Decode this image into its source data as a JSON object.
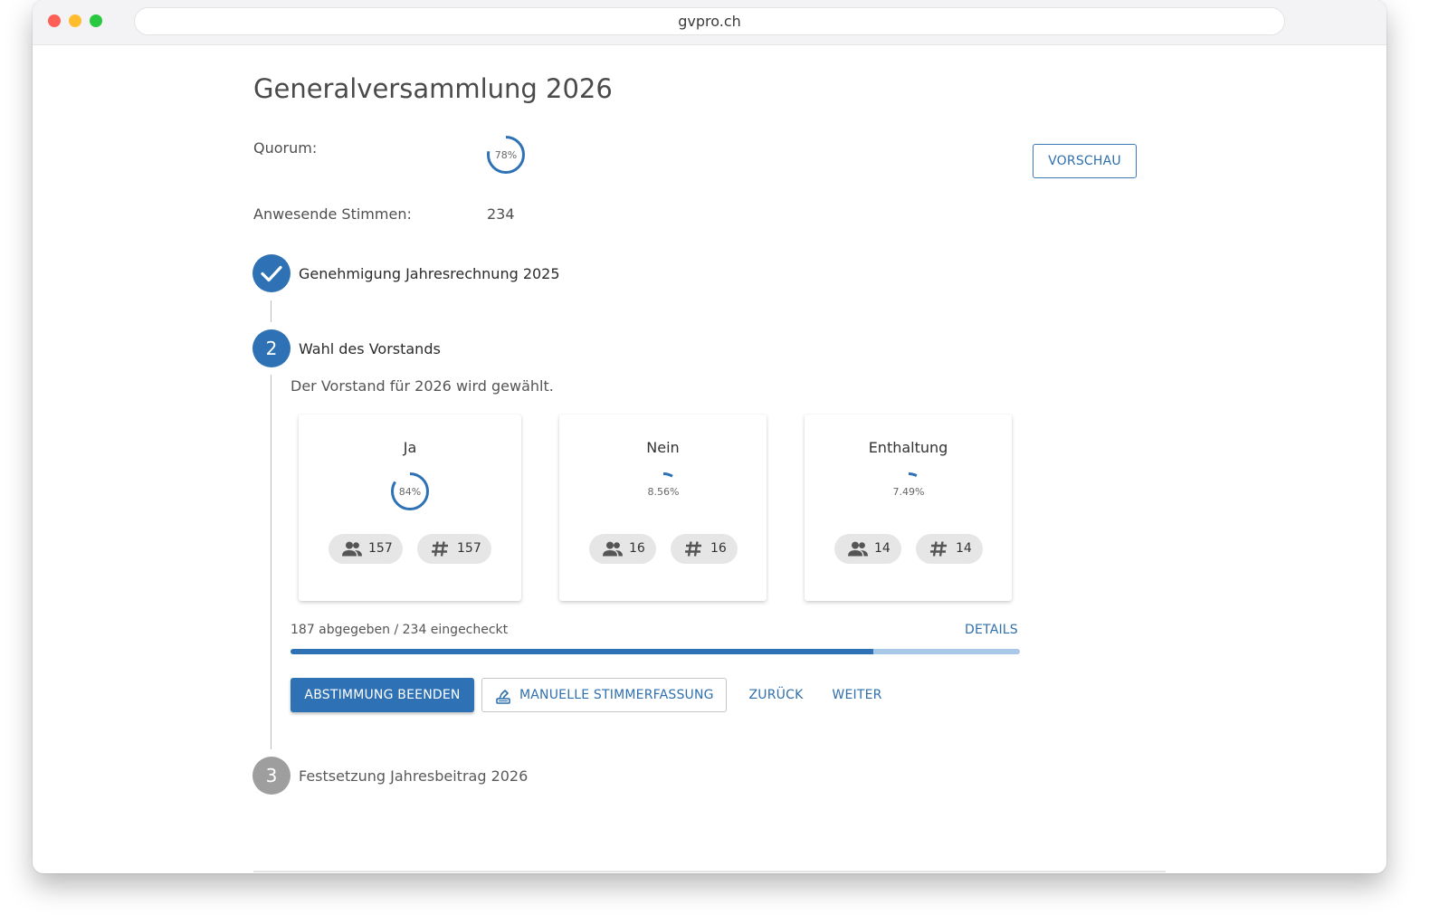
{
  "browser": {
    "url": "gvpro.ch"
  },
  "page": {
    "title": "Generalversammlung 2026",
    "quorum_label": "Quorum:",
    "quorum_percent_label": "78%",
    "quorum_fraction": 0.78,
    "votes_label": "Anwesende Stimmen:",
    "votes_value": "234",
    "preview_button": "VORSCHAU"
  },
  "steps": [
    {
      "number": "1",
      "title": "Genehmigung Jahresrechnung 2025",
      "status": "done"
    },
    {
      "number": "2",
      "title": "Wahl des Vorstands",
      "status": "active",
      "description": "Der Vorstand für 2026 wird gewählt."
    },
    {
      "number": "3",
      "title": "Festsetzung Jahresbeitrag 2026",
      "status": "pending"
    }
  ],
  "options": [
    {
      "label": "Ja",
      "percent_label": "84%",
      "fraction": 0.84,
      "persons": "157",
      "count": "157"
    },
    {
      "label": "Nein",
      "percent_label": "8.56%",
      "fraction": 0.0856,
      "persons": "16",
      "count": "16"
    },
    {
      "label": "Enthaltung",
      "percent_label": "7.49%",
      "fraction": 0.0749,
      "persons": "14",
      "count": "14"
    }
  ],
  "progress": {
    "text": "187 abgegeben / 234 eingecheckt",
    "fraction": 0.799,
    "details_link": "DETAILS"
  },
  "actions": {
    "end_vote": "ABSTIMMUNG BEENDEN",
    "manual_entry": "MANUELLE STIMMERFASSUNG",
    "back": "ZURÜCK",
    "next": "WEITER"
  },
  "icons": {
    "done_step": "check-icon",
    "persons": "group-icon",
    "count": "hash-icon",
    "manual_entry": "ballot-box-icon"
  },
  "colors": {
    "primary": "#2e72b5",
    "progress_track": "#a9c7e6",
    "pending_step": "#9e9e9e",
    "chip_bg": "#e6e6e6"
  }
}
